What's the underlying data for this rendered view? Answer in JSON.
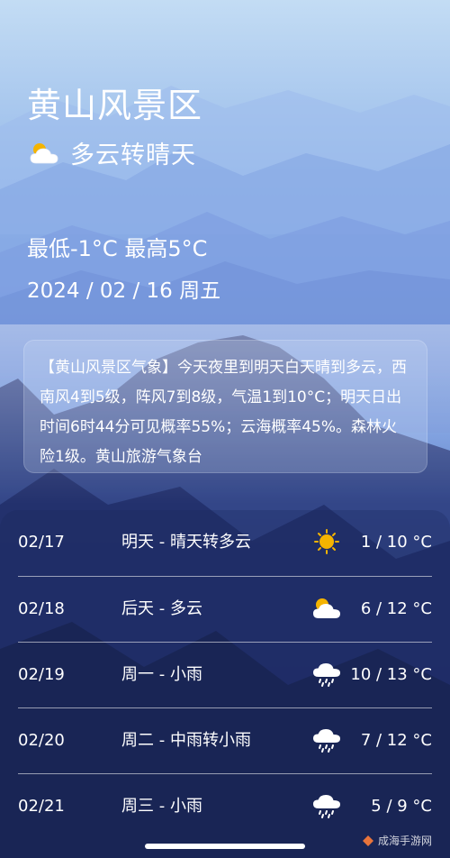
{
  "location": "黄山风景区",
  "current": {
    "condition": "多云转晴天",
    "condition_icon": "partly-cloudy-icon",
    "temp_range": "最低-1°C 最高5°C",
    "date": "2024 / 02 / 16  周五"
  },
  "description": "【黄山风景区气象】今天夜里到明天白天晴到多云，西南风4到5级，阵风7到8级，气温1到10°C；明天日出时间6时44分可见概率55%；云海概率45%。森林火险1级。黄山旅游气象台",
  "forecast": [
    {
      "date": "02/17",
      "label": "明天 - 晴天转多云",
      "icon": "sun-icon",
      "temp": "1 / 10 °C"
    },
    {
      "date": "02/18",
      "label": "后天 - 多云",
      "icon": "partly-cloudy-icon",
      "temp": "6 / 12 °C"
    },
    {
      "date": "02/19",
      "label": "周一 - 小雨",
      "icon": "rain-icon",
      "temp": "10 / 13 °C"
    },
    {
      "date": "02/20",
      "label": "周二 - 中雨转小雨",
      "icon": "rain-icon",
      "temp": "7 / 12 °C"
    },
    {
      "date": "02/21",
      "label": "周三 - 小雨",
      "icon": "rain-icon",
      "temp": "5 / 9 °C"
    }
  ],
  "watermark": "成海手游网",
  "colors": {
    "sun": "#f5b400",
    "cloud": "#ffffff",
    "sky_top": "#bcd6f2",
    "sky_bottom": "#2a3f88"
  }
}
